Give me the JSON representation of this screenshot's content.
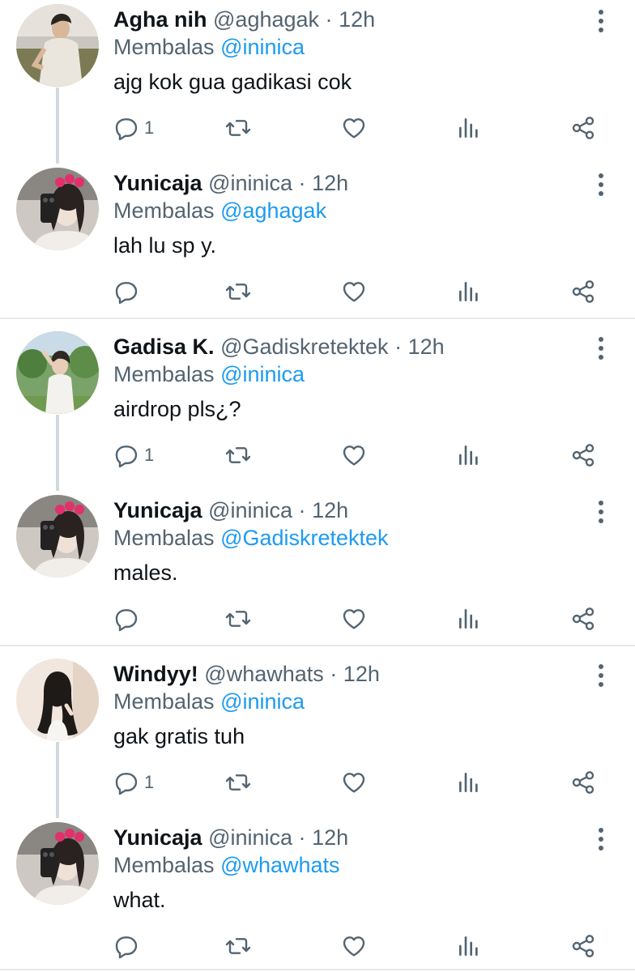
{
  "colors": {
    "accent": "#1d9bf0",
    "muted": "#536471",
    "text": "#0f1419",
    "line": "#cfd9de"
  },
  "tweets": [
    {
      "name": "Agha nih",
      "handle": "@aghagak",
      "dot": "·",
      "time": "12h",
      "replying_prefix": "Membalas",
      "replying_to": "@ininica",
      "text": "ajg kok gua gadikasi cok",
      "reply_count": "1",
      "avatar": "avatar-man-beach"
    },
    {
      "name": "Yunicaja",
      "handle": "@ininica",
      "dot": "·",
      "time": "12h",
      "replying_prefix": "Membalas",
      "replying_to": "@aghagak",
      "text": "lah lu sp y.",
      "reply_count": "",
      "avatar": "avatar-selfie-mirror"
    },
    {
      "name": "Gadisa K.",
      "handle": "@Gadiskretektek",
      "dot": "·",
      "time": "12h",
      "replying_prefix": "Membalas",
      "replying_to": "@ininica",
      "text": "airdrop pls¿?",
      "reply_count": "1",
      "avatar": "avatar-woman-garden"
    },
    {
      "name": "Yunicaja",
      "handle": "@ininica",
      "dot": "·",
      "time": "12h",
      "replying_prefix": "Membalas",
      "replying_to": "@Gadiskretektek",
      "text": "males.",
      "reply_count": "",
      "avatar": "avatar-selfie-mirror"
    },
    {
      "name": "Windyy!",
      "handle": "@whawhats",
      "dot": "·",
      "time": "12h",
      "replying_prefix": "Membalas",
      "replying_to": "@ininica",
      "text": "gak gratis tuh",
      "reply_count": "1",
      "avatar": "avatar-woman-portrait"
    },
    {
      "name": "Yunicaja",
      "handle": "@ininica",
      "dot": "·",
      "time": "12h",
      "replying_prefix": "Membalas",
      "replying_to": "@whawhats",
      "text": "what.",
      "reply_count": "",
      "avatar": "avatar-selfie-mirror"
    }
  ],
  "icons": [
    "reply-icon",
    "retweet-icon",
    "like-icon",
    "views-icon",
    "share-icon",
    "more-options-icon"
  ]
}
